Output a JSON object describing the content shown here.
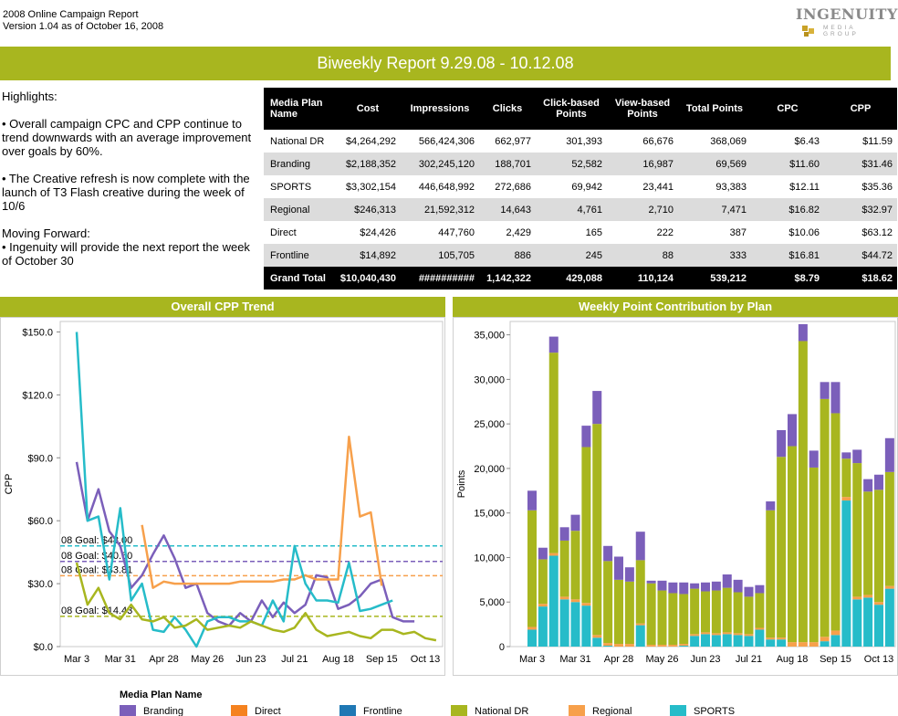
{
  "header": {
    "line1": "2008 Online Campaign Report",
    "line2": "Version 1.04 as of October 16, 2008",
    "logo_name": "INGENUITY",
    "logo_sub": "MEDIA GROUP"
  },
  "banner": {
    "title": "Biweekly Report 9.29.08 - 10.12.08"
  },
  "highlights": {
    "heading": "Highlights:",
    "bullet1": "•  Overall campaign CPC and CPP continue to trend downwards with an average improvement over goals by 60%.",
    "bullet2": "•  The Creative refresh is now complete with the launch of T3 Flash creative during the week of 10/6",
    "forward_heading": "Moving Forward:",
    "forward1": "• Ingenuity will provide the next report the week of October 30"
  },
  "table": {
    "headers": [
      "Media Plan Name",
      "Cost",
      "Impressions",
      "Clicks",
      "Click-based Points",
      "View-based Points",
      "Total Points",
      "CPC",
      "CPP"
    ],
    "rows": [
      [
        "National DR",
        "$4,264,292",
        "566,424,306",
        "662,977",
        "301,393",
        "66,676",
        "368,069",
        "$6.43",
        "$11.59"
      ],
      [
        "Branding",
        "$2,188,352",
        "302,245,120",
        "188,701",
        "52,582",
        "16,987",
        "69,569",
        "$11.60",
        "$31.46"
      ],
      [
        "SPORTS",
        "$3,302,154",
        "446,648,992",
        "272,686",
        "69,942",
        "23,441",
        "93,383",
        "$12.11",
        "$35.36"
      ],
      [
        "Regional",
        "$246,313",
        "21,592,312",
        "14,643",
        "4,761",
        "2,710",
        "7,471",
        "$16.82",
        "$32.97"
      ],
      [
        "Direct",
        "$24,426",
        "447,760",
        "2,429",
        "165",
        "222",
        "387",
        "$10.06",
        "$63.12"
      ],
      [
        "Frontline",
        "$14,892",
        "105,705",
        "886",
        "245",
        "88",
        "333",
        "$16.81",
        "$44.72"
      ]
    ],
    "total": [
      "Grand Total",
      "$10,040,430",
      "##########",
      "1,142,322",
      "429,088",
      "110,124",
      "539,212",
      "$8.79",
      "$18.62"
    ]
  },
  "panels": {
    "left_title": "Overall CPP Trend",
    "right_title": "Weekly Point Contribution by Plan"
  },
  "legend": {
    "title": "Media Plan Name",
    "items": [
      {
        "label": "Branding",
        "color": "#7b5fba"
      },
      {
        "label": "Direct",
        "color": "#f5821f"
      },
      {
        "label": "Frontline",
        "color": "#1f78b4"
      },
      {
        "label": "National DR",
        "color": "#a8b61f"
      },
      {
        "label": "Regional",
        "color": "#f7a04b"
      },
      {
        "label": "SPORTS",
        "color": "#26bcc9"
      }
    ]
  },
  "chart_data": [
    {
      "type": "line",
      "title": "Overall CPP Trend",
      "ylabel": "CPP",
      "xlabel": "",
      "ylim": [
        0,
        155
      ],
      "yticks": [
        0,
        30,
        60,
        90,
        120,
        150
      ],
      "ytick_labels": [
        "$0.0",
        "$30.0",
        "$60.0",
        "$90.0",
        "$120.0",
        "$150.0"
      ],
      "xtick_labels": [
        {
          "label": "Mar 3",
          "i": 0
        },
        {
          "label": "Mar 31",
          "i": 4
        },
        {
          "label": "Apr 28",
          "i": 8
        },
        {
          "label": "May 26",
          "i": 12
        },
        {
          "label": "Jun 23",
          "i": 16
        },
        {
          "label": "Jul 21",
          "i": 20
        },
        {
          "label": "Aug 18",
          "i": 24
        },
        {
          "label": "Sep 15",
          "i": 28
        },
        {
          "label": "Oct 13",
          "i": 32
        }
      ],
      "n_points": 32,
      "goals": [
        {
          "label": "08 Goal: $48.00",
          "value": 48.0,
          "color": "#26bcc9"
        },
        {
          "label": "08 Goal: $40.60",
          "value": 40.6,
          "color": "#7b5fba"
        },
        {
          "label": "08 Goal: $33.81",
          "value": 33.81,
          "color": "#f7a04b"
        },
        {
          "label": "08 Goal: $14.43",
          "value": 14.43,
          "color": "#a8b61f"
        }
      ],
      "series": [
        {
          "name": "Branding",
          "color": "#7b5fba",
          "start": 0,
          "values": [
            88,
            60,
            75,
            55,
            48,
            28,
            34,
            44,
            53,
            42,
            28,
            30,
            16,
            12,
            10,
            16,
            12,
            22,
            14,
            21,
            16,
            20,
            34,
            33,
            18,
            20,
            24,
            30,
            32,
            14,
            12,
            12
          ]
        },
        {
          "name": "Regional",
          "color": "#f7a04b",
          "start": 6,
          "values": [
            58,
            28,
            31,
            30,
            30,
            30,
            30,
            30,
            30,
            31,
            31,
            31,
            31,
            32,
            32,
            34,
            32,
            32,
            32,
            100,
            62,
            64,
            29
          ]
        },
        {
          "name": "SPORTS",
          "color": "#26bcc9",
          "start": 0,
          "values": [
            150,
            60,
            62,
            32,
            66,
            22,
            30,
            8,
            7,
            14,
            8,
            0,
            12,
            14,
            14,
            12,
            12,
            10,
            22,
            12,
            48,
            30,
            22,
            22,
            21,
            40,
            17,
            18,
            20,
            22
          ]
        },
        {
          "name": "National DR",
          "color": "#a8b61f",
          "start": 0,
          "values": [
            40,
            20,
            28,
            16,
            13,
            20,
            13,
            12,
            14,
            9,
            10,
            13,
            8,
            9,
            10,
            9,
            12,
            10,
            8,
            7,
            9,
            16,
            8,
            5,
            6,
            7,
            5,
            4,
            8,
            8,
            6,
            7,
            4,
            3
          ]
        }
      ]
    },
    {
      "type": "bar",
      "stacked": true,
      "title": "Weekly Point Contribution by Plan",
      "ylabel": "Points",
      "xlabel": "",
      "ylim": [
        0,
        36500
      ],
      "yticks": [
        0,
        5000,
        10000,
        15000,
        20000,
        25000,
        30000,
        35000
      ],
      "ytick_labels": [
        "0",
        "5,000",
        "10,000",
        "15,000",
        "20,000",
        "25,000",
        "30,000",
        "35,000"
      ],
      "xtick_labels": [
        {
          "label": "Mar 3",
          "i": 0
        },
        {
          "label": "Mar 31",
          "i": 4
        },
        {
          "label": "Apr 28",
          "i": 8
        },
        {
          "label": "May 26",
          "i": 12
        },
        {
          "label": "Jun 23",
          "i": 16
        },
        {
          "label": "Jul 21",
          "i": 20
        },
        {
          "label": "Aug 18",
          "i": 24
        },
        {
          "label": "Sep 15",
          "i": 28
        },
        {
          "label": "Oct 13",
          "i": 32
        }
      ],
      "n_bars": 33,
      "series": [
        {
          "name": "SPORTS",
          "color": "#26bcc9",
          "values": [
            1900,
            4500,
            10200,
            5300,
            5000,
            4600,
            1000,
            100,
            0,
            0,
            2400,
            0,
            0,
            0,
            100,
            1200,
            1400,
            1300,
            1400,
            1300,
            1200,
            1900,
            800,
            800,
            0,
            0,
            0,
            600,
            1300,
            16400,
            5300,
            5500,
            4700,
            6500
          ]
        },
        {
          "name": "Regional",
          "color": "#f7a04b",
          "values": [
            300,
            300,
            300,
            300,
            300,
            300,
            300,
            300,
            300,
            300,
            200,
            200,
            200,
            200,
            200,
            200,
            200,
            200,
            200,
            200,
            200,
            200,
            200,
            200,
            500,
            500,
            500,
            500,
            500,
            400,
            300,
            300,
            300,
            300
          ]
        },
        {
          "name": "National DR",
          "color": "#a8b61f",
          "values": [
            13100,
            5000,
            22500,
            6300,
            7700,
            17500,
            23700,
            9200,
            7200,
            7000,
            7100,
            6900,
            6100,
            5800,
            5600,
            5100,
            4600,
            4800,
            5000,
            4600,
            4200,
            3900,
            14300,
            20300,
            22000,
            33800,
            19600,
            26700,
            24400,
            4300,
            15000,
            11600,
            12600,
            12800
          ]
        },
        {
          "name": "Branding",
          "color": "#7b5fba",
          "values": [
            2200,
            1300,
            1800,
            1500,
            1800,
            2400,
            3700,
            1700,
            2600,
            1600,
            3200,
            300,
            1100,
            1200,
            1300,
            600,
            1000,
            1000,
            1500,
            1400,
            1100,
            900,
            1000,
            3000,
            3600,
            1900,
            1900,
            1900,
            3500,
            700,
            1500,
            1400,
            1700,
            3800
          ]
        }
      ]
    }
  ]
}
